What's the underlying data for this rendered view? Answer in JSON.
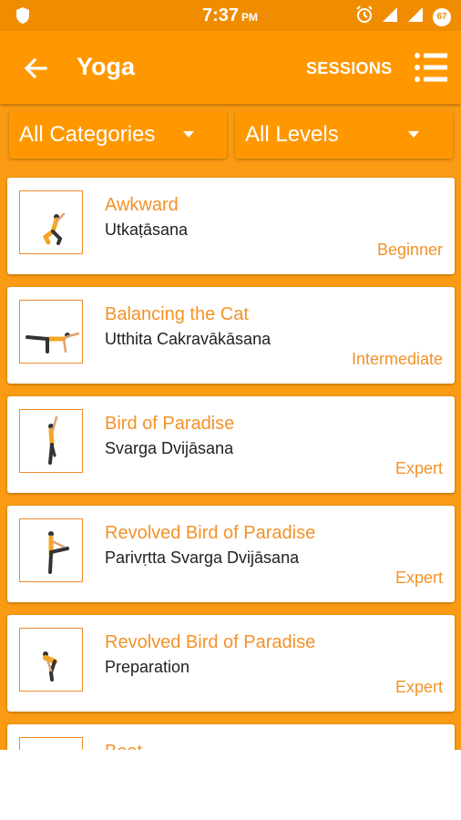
{
  "status": {
    "time": "7:37",
    "ampm": "PM",
    "battery": "67"
  },
  "appbar": {
    "title": "Yoga",
    "sessions_label": "SESSIONS"
  },
  "filters": {
    "category": "All Categories",
    "level": "All Levels"
  },
  "poses": [
    {
      "name": "Awkward",
      "sanskrit": "Utkaṭāsana",
      "level": "Beginner"
    },
    {
      "name": "Balancing the Cat",
      "sanskrit": "Utthita Cakravākāsana",
      "level": "Intermediate"
    },
    {
      "name": "Bird of Paradise",
      "sanskrit": "Svarga Dvijāsana",
      "level": "Expert"
    },
    {
      "name": "Revolved Bird of Paradise",
      "sanskrit": "Parivṛtta Svarga Dvijāsana",
      "level": "Expert"
    },
    {
      "name": "Revolved Bird of Paradise",
      "sanskrit": "Preparation",
      "level": "Expert"
    },
    {
      "name": "Boat",
      "sanskrit": "",
      "level": ""
    }
  ],
  "colors": {
    "primary": "#ff9800",
    "status_bar": "#f08c00",
    "accent_text": "#f39228"
  },
  "icons": [
    "shield-icon",
    "alarm-icon",
    "signal-icon",
    "battery-icon",
    "back-arrow-icon",
    "list-menu-icon",
    "dropdown-caret-icon"
  ]
}
